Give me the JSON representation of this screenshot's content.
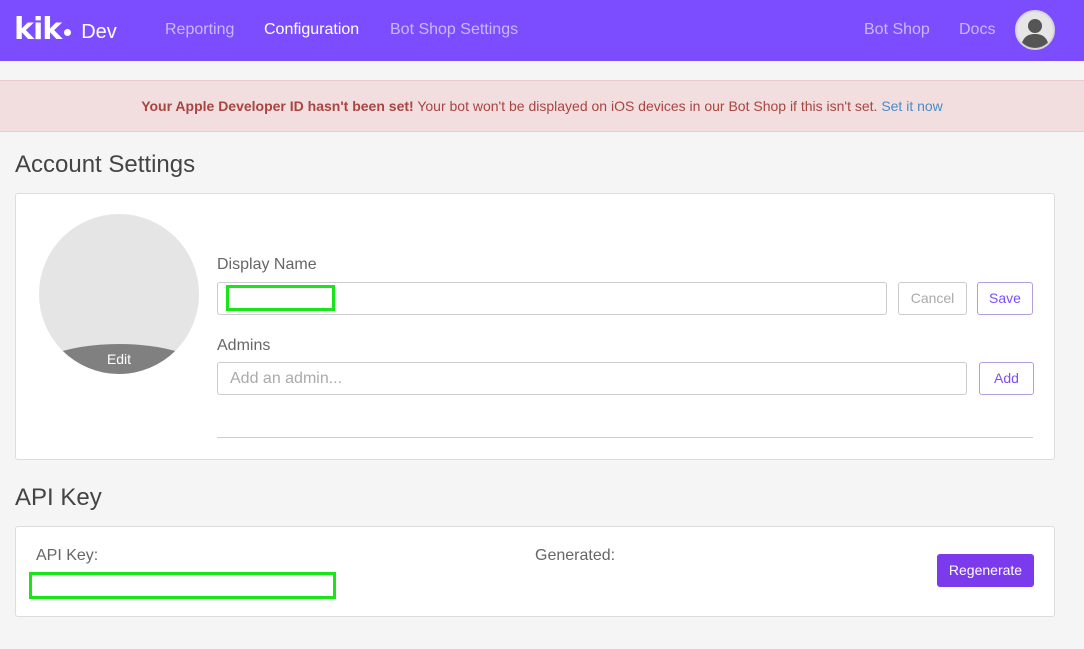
{
  "brand": {
    "logo_text": "kik",
    "suffix": "Dev"
  },
  "nav": {
    "reporting": "Reporting",
    "configuration": "Configuration",
    "bot_shop_settings": "Bot Shop Settings",
    "bot_shop": "Bot Shop",
    "docs": "Docs"
  },
  "alert": {
    "bold": "Your Apple Developer ID hasn't been set!",
    "text": " Your bot won't be displayed on iOS devices in our Bot Shop if this isn't set. ",
    "link": "Set it now"
  },
  "account": {
    "title": "Account Settings",
    "photo_edit": "Edit",
    "display_name_label": "Display Name",
    "display_name_value": "",
    "cancel": "Cancel",
    "save": "Save",
    "admins_label": "Admins",
    "admins_placeholder": "Add an admin...",
    "add": "Add"
  },
  "api": {
    "title": "API Key",
    "key_label": "API Key:",
    "generated_label": "Generated:",
    "regenerate": "Regenerate"
  },
  "colors": {
    "brand": "#7c4dff",
    "alert_bg": "#f2dede",
    "alert_text": "#a94442",
    "redaction": "#19e619"
  }
}
